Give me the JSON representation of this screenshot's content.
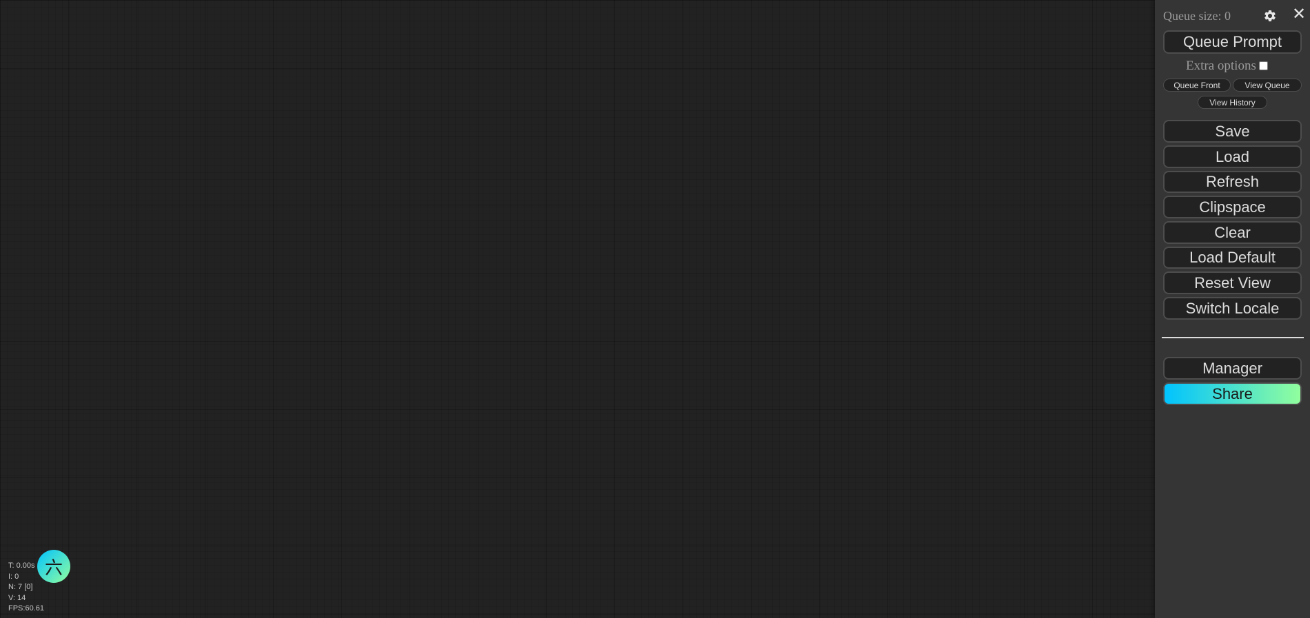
{
  "stats": {
    "t": "T: 0.00s",
    "i": "I: 0",
    "n": "N: 7 [0]",
    "v": "V: 14",
    "fps": "FPS:60.61"
  },
  "badge": {
    "glyph": "六"
  },
  "menu": {
    "queue_size": "Queue size: 0",
    "queue_prompt": "Queue Prompt",
    "extra_options": "Extra options",
    "extra_options_checked": false,
    "queue_front": "Queue Front",
    "view_queue": "View Queue",
    "view_history": "View History",
    "buttons": {
      "save": "Save",
      "load": "Load",
      "refresh": "Refresh",
      "clipspace": "Clipspace",
      "clear": "Clear",
      "load_default": "Load Default",
      "reset_view": "Reset View",
      "switch_locale": "Switch Locale",
      "manager": "Manager",
      "share": "Share"
    }
  },
  "colors": {
    "canvas_bg": "#222222",
    "menu_bg": "#353535",
    "share_gradient_start": "#00c3ff",
    "share_gradient_end": "#92fe9d"
  },
  "icons": {
    "settings": "gear-icon",
    "close": "close-icon"
  }
}
